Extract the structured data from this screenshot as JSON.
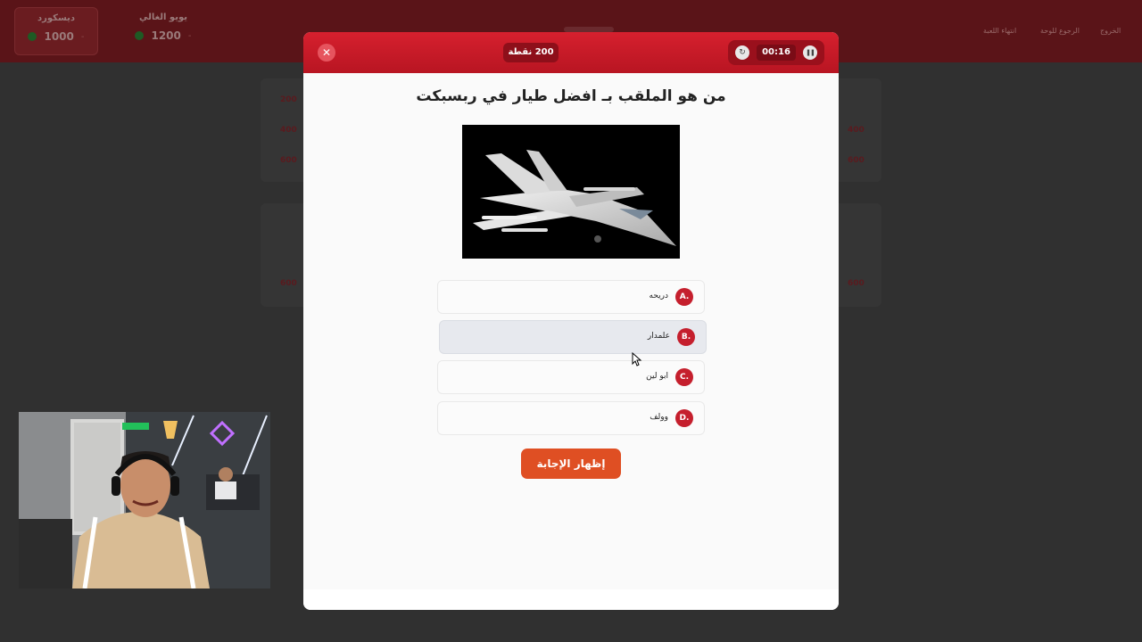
{
  "header": {
    "teams": [
      {
        "name": "ديسكورد",
        "score": "1000",
        "minus": "-"
      },
      {
        "name": "يويو الغالي",
        "score": "1200",
        "minus": "-"
      }
    ],
    "nav": {
      "exit": "الخروج",
      "back_to_board": "الرجوع للوحة",
      "end_game": "انتهاء اللعبة"
    }
  },
  "board": {
    "values": [
      "200",
      "400",
      "600"
    ]
  },
  "modal": {
    "points": "200 نقطة",
    "timer": "00:16",
    "question": "من هو الملقب بـ افضل طيار في ربسبكت",
    "options": [
      {
        "letter": "A.",
        "text": "دريحه"
      },
      {
        "letter": "B.",
        "text": "علمدار"
      },
      {
        "letter": "C.",
        "text": "ابو لين"
      },
      {
        "letter": "D.",
        "text": "وولف"
      }
    ],
    "selected_option": "B.",
    "reveal_label": "إظهار الإجابة"
  },
  "icons": {
    "close": "close-icon",
    "reset": "reset-timer-icon",
    "pause": "pause-icon"
  },
  "colors": {
    "brand_red": "#d6202e",
    "reveal_orange": "#df4f23",
    "option_letter": "#c51f2d"
  }
}
